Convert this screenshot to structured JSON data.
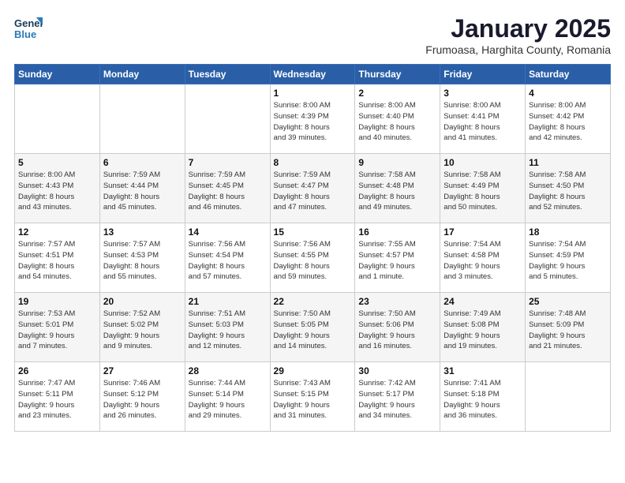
{
  "header": {
    "logo_general": "General",
    "logo_blue": "Blue",
    "title": "January 2025",
    "subtitle": "Frumoasa, Harghita County, Romania"
  },
  "calendar": {
    "days_of_week": [
      "Sunday",
      "Monday",
      "Tuesday",
      "Wednesday",
      "Thursday",
      "Friday",
      "Saturday"
    ],
    "weeks": [
      [
        {
          "day": "",
          "info": ""
        },
        {
          "day": "",
          "info": ""
        },
        {
          "day": "",
          "info": ""
        },
        {
          "day": "1",
          "info": "Sunrise: 8:00 AM\nSunset: 4:39 PM\nDaylight: 8 hours\nand 39 minutes."
        },
        {
          "day": "2",
          "info": "Sunrise: 8:00 AM\nSunset: 4:40 PM\nDaylight: 8 hours\nand 40 minutes."
        },
        {
          "day": "3",
          "info": "Sunrise: 8:00 AM\nSunset: 4:41 PM\nDaylight: 8 hours\nand 41 minutes."
        },
        {
          "day": "4",
          "info": "Sunrise: 8:00 AM\nSunset: 4:42 PM\nDaylight: 8 hours\nand 42 minutes."
        }
      ],
      [
        {
          "day": "5",
          "info": "Sunrise: 8:00 AM\nSunset: 4:43 PM\nDaylight: 8 hours\nand 43 minutes."
        },
        {
          "day": "6",
          "info": "Sunrise: 7:59 AM\nSunset: 4:44 PM\nDaylight: 8 hours\nand 45 minutes."
        },
        {
          "day": "7",
          "info": "Sunrise: 7:59 AM\nSunset: 4:45 PM\nDaylight: 8 hours\nand 46 minutes."
        },
        {
          "day": "8",
          "info": "Sunrise: 7:59 AM\nSunset: 4:47 PM\nDaylight: 8 hours\nand 47 minutes."
        },
        {
          "day": "9",
          "info": "Sunrise: 7:58 AM\nSunset: 4:48 PM\nDaylight: 8 hours\nand 49 minutes."
        },
        {
          "day": "10",
          "info": "Sunrise: 7:58 AM\nSunset: 4:49 PM\nDaylight: 8 hours\nand 50 minutes."
        },
        {
          "day": "11",
          "info": "Sunrise: 7:58 AM\nSunset: 4:50 PM\nDaylight: 8 hours\nand 52 minutes."
        }
      ],
      [
        {
          "day": "12",
          "info": "Sunrise: 7:57 AM\nSunset: 4:51 PM\nDaylight: 8 hours\nand 54 minutes."
        },
        {
          "day": "13",
          "info": "Sunrise: 7:57 AM\nSunset: 4:53 PM\nDaylight: 8 hours\nand 55 minutes."
        },
        {
          "day": "14",
          "info": "Sunrise: 7:56 AM\nSunset: 4:54 PM\nDaylight: 8 hours\nand 57 minutes."
        },
        {
          "day": "15",
          "info": "Sunrise: 7:56 AM\nSunset: 4:55 PM\nDaylight: 8 hours\nand 59 minutes."
        },
        {
          "day": "16",
          "info": "Sunrise: 7:55 AM\nSunset: 4:57 PM\nDaylight: 9 hours\nand 1 minute."
        },
        {
          "day": "17",
          "info": "Sunrise: 7:54 AM\nSunset: 4:58 PM\nDaylight: 9 hours\nand 3 minutes."
        },
        {
          "day": "18",
          "info": "Sunrise: 7:54 AM\nSunset: 4:59 PM\nDaylight: 9 hours\nand 5 minutes."
        }
      ],
      [
        {
          "day": "19",
          "info": "Sunrise: 7:53 AM\nSunset: 5:01 PM\nDaylight: 9 hours\nand 7 minutes."
        },
        {
          "day": "20",
          "info": "Sunrise: 7:52 AM\nSunset: 5:02 PM\nDaylight: 9 hours\nand 9 minutes."
        },
        {
          "day": "21",
          "info": "Sunrise: 7:51 AM\nSunset: 5:03 PM\nDaylight: 9 hours\nand 12 minutes."
        },
        {
          "day": "22",
          "info": "Sunrise: 7:50 AM\nSunset: 5:05 PM\nDaylight: 9 hours\nand 14 minutes."
        },
        {
          "day": "23",
          "info": "Sunrise: 7:50 AM\nSunset: 5:06 PM\nDaylight: 9 hours\nand 16 minutes."
        },
        {
          "day": "24",
          "info": "Sunrise: 7:49 AM\nSunset: 5:08 PM\nDaylight: 9 hours\nand 19 minutes."
        },
        {
          "day": "25",
          "info": "Sunrise: 7:48 AM\nSunset: 5:09 PM\nDaylight: 9 hours\nand 21 minutes."
        }
      ],
      [
        {
          "day": "26",
          "info": "Sunrise: 7:47 AM\nSunset: 5:11 PM\nDaylight: 9 hours\nand 23 minutes."
        },
        {
          "day": "27",
          "info": "Sunrise: 7:46 AM\nSunset: 5:12 PM\nDaylight: 9 hours\nand 26 minutes."
        },
        {
          "day": "28",
          "info": "Sunrise: 7:44 AM\nSunset: 5:14 PM\nDaylight: 9 hours\nand 29 minutes."
        },
        {
          "day": "29",
          "info": "Sunrise: 7:43 AM\nSunset: 5:15 PM\nDaylight: 9 hours\nand 31 minutes."
        },
        {
          "day": "30",
          "info": "Sunrise: 7:42 AM\nSunset: 5:17 PM\nDaylight: 9 hours\nand 34 minutes."
        },
        {
          "day": "31",
          "info": "Sunrise: 7:41 AM\nSunset: 5:18 PM\nDaylight: 9 hours\nand 36 minutes."
        },
        {
          "day": "",
          "info": ""
        }
      ]
    ]
  }
}
